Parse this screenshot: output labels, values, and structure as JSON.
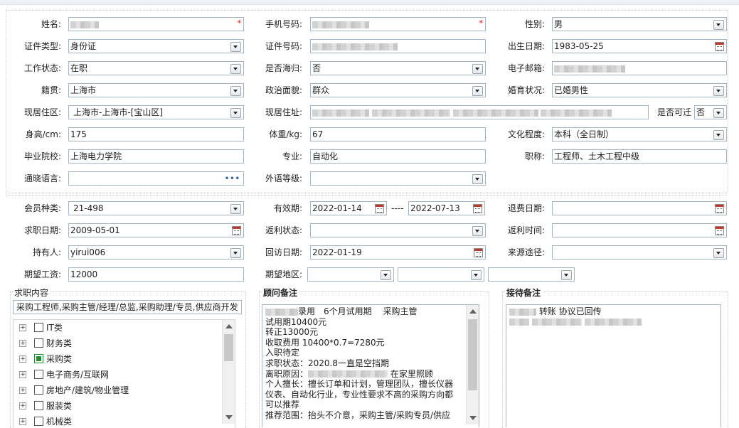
{
  "personal": {
    "name_label": "姓名:",
    "phone_label": "手机号码:",
    "gender_label": "性别:",
    "gender": "男",
    "id_type_label": "证件类型:",
    "id_type": "身份证",
    "id_no_label": "证件号码:",
    "birth_label": "出生日期:",
    "birth": "1983-05-25",
    "work_status_label": "工作状态:",
    "work_status": "在职",
    "overseas_label": "是否海归:",
    "overseas": "否",
    "email_label": "电子邮箱:",
    "native_label": "籍贯:",
    "native": "上海市",
    "political_label": "政治面貌:",
    "political": "群众",
    "marital_label": "婚育状况:",
    "marital": "已婚男性",
    "district_label": "现居住区:",
    "district": "上海市-上海市-[宝山区]",
    "address_label": "现居住址:",
    "relocate_label": "是否可迁",
    "relocate": "否",
    "height_label": "身高/cm:",
    "height": "175",
    "weight_label": "体重/kg:",
    "weight": "67",
    "education_label": "文化程度:",
    "education": "本科（全日制）",
    "school_label": "毕业院校:",
    "school": "上海电力学院",
    "major_label": "专业:",
    "major": "自动化",
    "title_label": "职称:",
    "title": "工程师、土木工程中级",
    "language_label": "通晓语言:",
    "language_more": "•••",
    "foreign_level_label": "外语等级:",
    "required_mark": "*"
  },
  "membership": {
    "type_label": "会员种类:",
    "type": "21-498",
    "valid_label": "有效期:",
    "valid_from": "2022-01-14",
    "valid_sep": "----",
    "valid_to": "2022-07-13",
    "refund_date_label": "退费日期:",
    "job_date_label": "求职日期:",
    "job_date": "2009-05-01",
    "rebate_status_label": "返利状态:",
    "rebate_time_label": "返利时间:",
    "holder_label": "持有人:",
    "holder": "yirui006",
    "visit_date_label": "回访日期:",
    "visit_date": "2022-01-19",
    "source_label": "来源途径:",
    "salary_label": "期望工资:",
    "salary": "12000",
    "region_label": "期望地区:"
  },
  "job_intent": {
    "title": "求职内容",
    "summary": "采购工程师,采购主管/经理/总监,采购助理/专员,供应商开发",
    "categories": [
      {
        "label": "IT类",
        "checked": false
      },
      {
        "label": "财务类",
        "checked": false
      },
      {
        "label": "采购类",
        "checked": true
      },
      {
        "label": "电子商务/互联网",
        "checked": false
      },
      {
        "label": "房地产/建筑/物业管理",
        "checked": false
      },
      {
        "label": "服装类",
        "checked": false
      },
      {
        "label": "机械类",
        "checked": false
      }
    ]
  },
  "consultant_notes": {
    "title": "顾问备注",
    "lines": [
      "录用　6个月试用期　 采购主管",
      "试用期10400元",
      "转正13000元",
      "收取费用 10400*0.7=7280元",
      "入职待定",
      "求职状态：2020.8一直是空挡期",
      "离职原因：",
      "在家里照顾",
      "个人擅长：擅长订单和计划，管理团队，擅长仪器",
      "仪表、自动化行业，专业性要求不高的采购方向都",
      "可以推荐",
      "推荐范围：抬头不介意，采购主管/采购专员/供应"
    ]
  },
  "reception_notes": {
    "title": "接待备注",
    "line1": "转账 协议已回传"
  },
  "icons": {
    "dropdown": "chevron-down-icon",
    "calendar": "calendar-icon",
    "tree_expand": "plus-icon"
  },
  "colors": {
    "border": "#a6b4c4",
    "checked": "#1f8f2f",
    "required": "#dd0000",
    "link": "#2a5db0"
  }
}
